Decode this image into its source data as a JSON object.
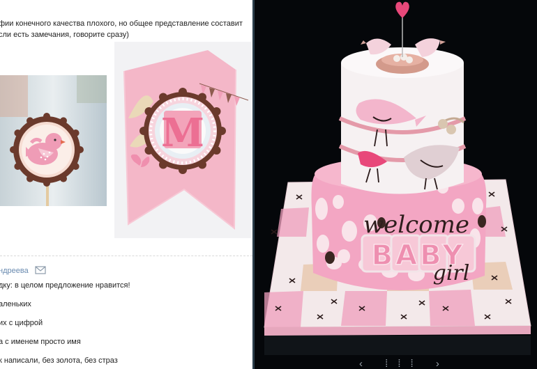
{
  "post": {
    "intro_line1": "фии конечного качества плохого, но общее представление составит",
    "intro_line2": "сли есть замечания, говорите сразу)"
  },
  "topper": {
    "letter": "M"
  },
  "comment": {
    "author": "ндреева",
    "lead": "дку: в целом предложение нравится!",
    "items": [
      "аленьких",
      "их с цифрой",
      "а с именем просто имя",
      "к написали, без золота, без страз"
    ]
  },
  "cake": {
    "line1": "welcome",
    "line2": "BABY",
    "line3": "girl"
  },
  "viewer": {
    "nav": "‹ ⁞⁞⁞ ›"
  },
  "colors": {
    "pink": "#f2b8c8",
    "brown": "#6b3a2c",
    "cake_background": "#05070a"
  }
}
